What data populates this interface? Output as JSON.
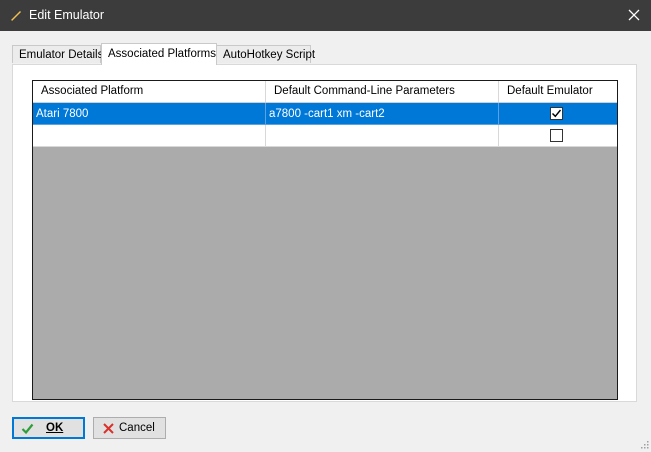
{
  "window": {
    "title": "Edit Emulator",
    "close_icon": "close-icon",
    "app_icon": "pencil-icon"
  },
  "tabs": [
    {
      "label": "Emulator Details",
      "active": false
    },
    {
      "label": "Associated Platforms",
      "active": true
    },
    {
      "label": "AutoHotkey Script",
      "active": false
    }
  ],
  "grid": {
    "columns": [
      "Associated Platform",
      "Default Command-Line Parameters",
      "Default Emulator"
    ],
    "rows": [
      {
        "platform": "Atari 7800",
        "params": "a7800 -cart1 xm -cart2",
        "default": true,
        "selected": true
      },
      {
        "platform": "",
        "params": "",
        "default": false,
        "selected": false
      }
    ]
  },
  "buttons": {
    "ok_label": "OK",
    "ok_icon": "checkmark-icon",
    "cancel_label": "Cancel",
    "cancel_icon": "x-icon"
  },
  "colors": {
    "selection": "#0078d7",
    "titlebar": "#3c3c3c",
    "grid_background": "#ababab"
  }
}
